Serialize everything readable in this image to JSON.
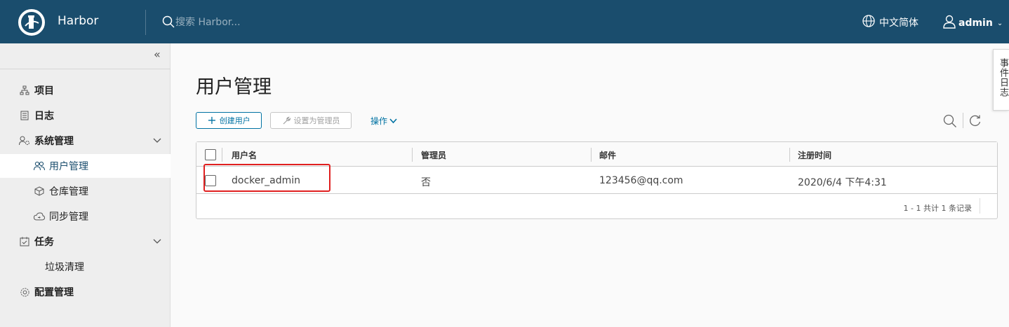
{
  "header": {
    "brand": "Harbor",
    "search_placeholder": "搜索 Harbor...",
    "language": "中文简体",
    "user": "admin"
  },
  "sidebar": {
    "items": [
      {
        "label": "项目",
        "icon": "project-icon"
      },
      {
        "label": "日志",
        "icon": "log-icon"
      },
      {
        "label": "系统管理",
        "icon": "system-admin-icon"
      },
      {
        "label": "用户管理",
        "icon": "users-icon"
      },
      {
        "label": "仓库管理",
        "icon": "registry-icon"
      },
      {
        "label": "同步管理",
        "icon": "replication-icon"
      },
      {
        "label": "任务",
        "icon": "task-icon"
      },
      {
        "label": "垃圾清理",
        "icon": ""
      },
      {
        "label": "配置管理",
        "icon": "gear-icon"
      }
    ]
  },
  "main": {
    "title": "用户管理",
    "create_user_label": "创建用户",
    "set_admin_label": "设置为管理员",
    "actions_label": "操作",
    "columns": [
      "用户名",
      "管理员",
      "邮件",
      "注册时间"
    ],
    "rows": [
      {
        "username": "docker_admin",
        "admin": "否",
        "email": "123456@qq.com",
        "registered": "2020/6/4 下午4:31"
      }
    ],
    "pagination": "1 - 1 共计 1 条记录"
  },
  "event_log_tab": "事件日志",
  "colors": {
    "header_bg": "#1a4d6d",
    "accent": "#0072a3",
    "highlight": "#e02020"
  }
}
